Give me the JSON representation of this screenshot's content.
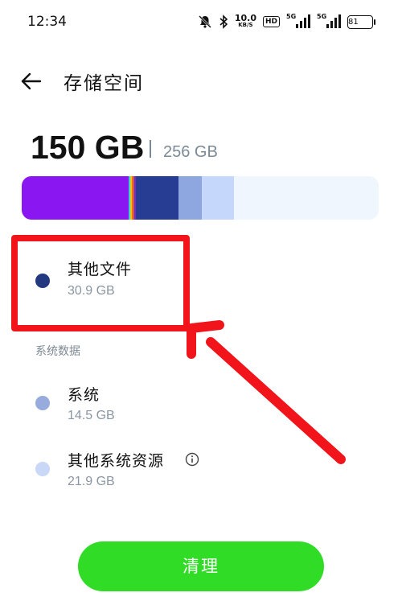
{
  "status_bar": {
    "time": "12:34",
    "net_speed_value": "10.0",
    "net_speed_unit": "KB/S",
    "hd_badge": "HD",
    "sim1_tag": "5G",
    "sim2_tag": "5G",
    "battery": "81"
  },
  "header": {
    "title": "存储空间"
  },
  "storage": {
    "used": "150 GB",
    "total": "256 GB",
    "segments": [
      {
        "name": "apps",
        "color": "#8a17f2",
        "fraction": 0.3
      },
      {
        "name": "mixed",
        "color": "#e0552a",
        "fraction": 0.02
      },
      {
        "name": "other-files",
        "color": "#273c93",
        "fraction": 0.12
      },
      {
        "name": "system",
        "color": "#8ea7e0",
        "fraction": 0.065
      },
      {
        "name": "other-system-resources",
        "color": "#c5d8fb",
        "fraction": 0.09
      }
    ]
  },
  "items": {
    "other_files": {
      "title": "其他文件",
      "size": "30.9 GB",
      "color": "#22387f"
    },
    "section_label": "系统数据",
    "system": {
      "title": "系统",
      "size": "14.5 GB",
      "color": "#97acdd"
    },
    "other_system": {
      "title": "其他系统资源",
      "size": "21.9 GB",
      "color": "#c8d8f6"
    }
  },
  "actions": {
    "clean_label": "清理"
  },
  "icons": {
    "back": "arrow-left-icon",
    "info": "info-icon",
    "mute": "bell-off-icon",
    "bluetooth": "bluetooth-icon"
  }
}
